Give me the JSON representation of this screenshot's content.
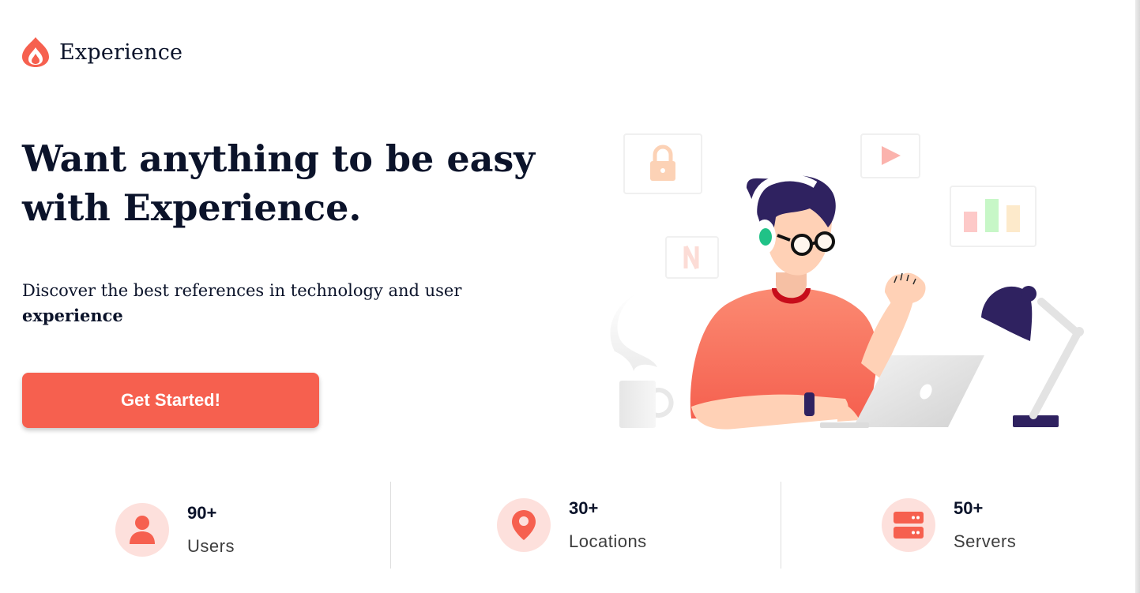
{
  "brand": {
    "name": "Experience",
    "icon": "flame-logo-icon",
    "accent": "#f6604f"
  },
  "hero": {
    "title_line1": "Want anything to be easy",
    "title_line2": "with Experience.",
    "subtitle": "Discover the best references in technology and user",
    "subtitle_bold": "experience",
    "cta_label": "Get Started!"
  },
  "illustration": {
    "icon": "person-with-laptop-illustration"
  },
  "stats": [
    {
      "value": "90+",
      "label": "Users",
      "icon": "user-icon"
    },
    {
      "value": "30+",
      "label": "Locations",
      "icon": "location-pin-icon"
    },
    {
      "value": "50+",
      "label": "Servers",
      "icon": "server-icon"
    }
  ]
}
